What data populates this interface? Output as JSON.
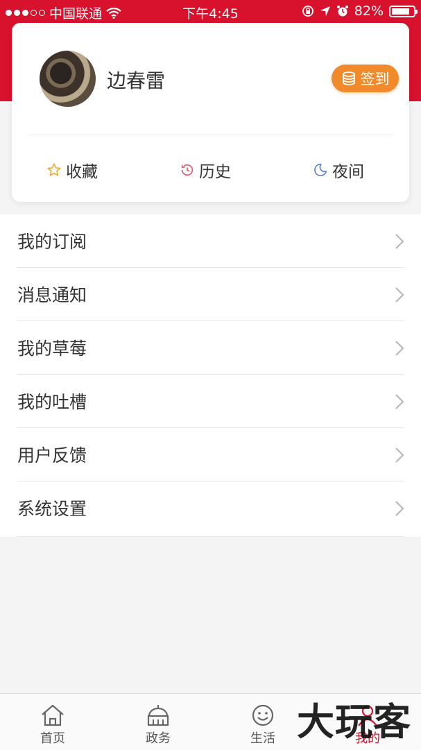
{
  "status_bar": {
    "carrier": "中国联通",
    "time": "下午4:45",
    "battery": "82%",
    "battery_level": 0.82
  },
  "profile": {
    "username": "边春雷",
    "checkin_label": "签到"
  },
  "quick_actions": [
    {
      "label": "收藏",
      "icon": "star-icon",
      "color": "#e8a93a"
    },
    {
      "label": "历史",
      "icon": "clock-icon",
      "color": "#e05a6a"
    },
    {
      "label": "夜间",
      "icon": "moon-icon",
      "color": "#5a7fd6"
    }
  ],
  "menu": [
    {
      "label": "我的订阅"
    },
    {
      "label": "消息通知"
    },
    {
      "label": "我的草莓"
    },
    {
      "label": "我的吐槽"
    },
    {
      "label": "用户反馈"
    },
    {
      "label": "系统设置"
    }
  ],
  "tab_bar": [
    {
      "label": "首页",
      "icon": "home-icon",
      "active": false
    },
    {
      "label": "政务",
      "icon": "government-building-icon",
      "active": false
    },
    {
      "label": "生活",
      "icon": "smiley-face-icon",
      "active": false
    },
    {
      "label": "我的",
      "icon": "user-icon",
      "active": true
    }
  ],
  "watermark": "大玩客",
  "colors": {
    "brand_red": "#d8112d",
    "checkin_orange": "#f08a2b"
  }
}
